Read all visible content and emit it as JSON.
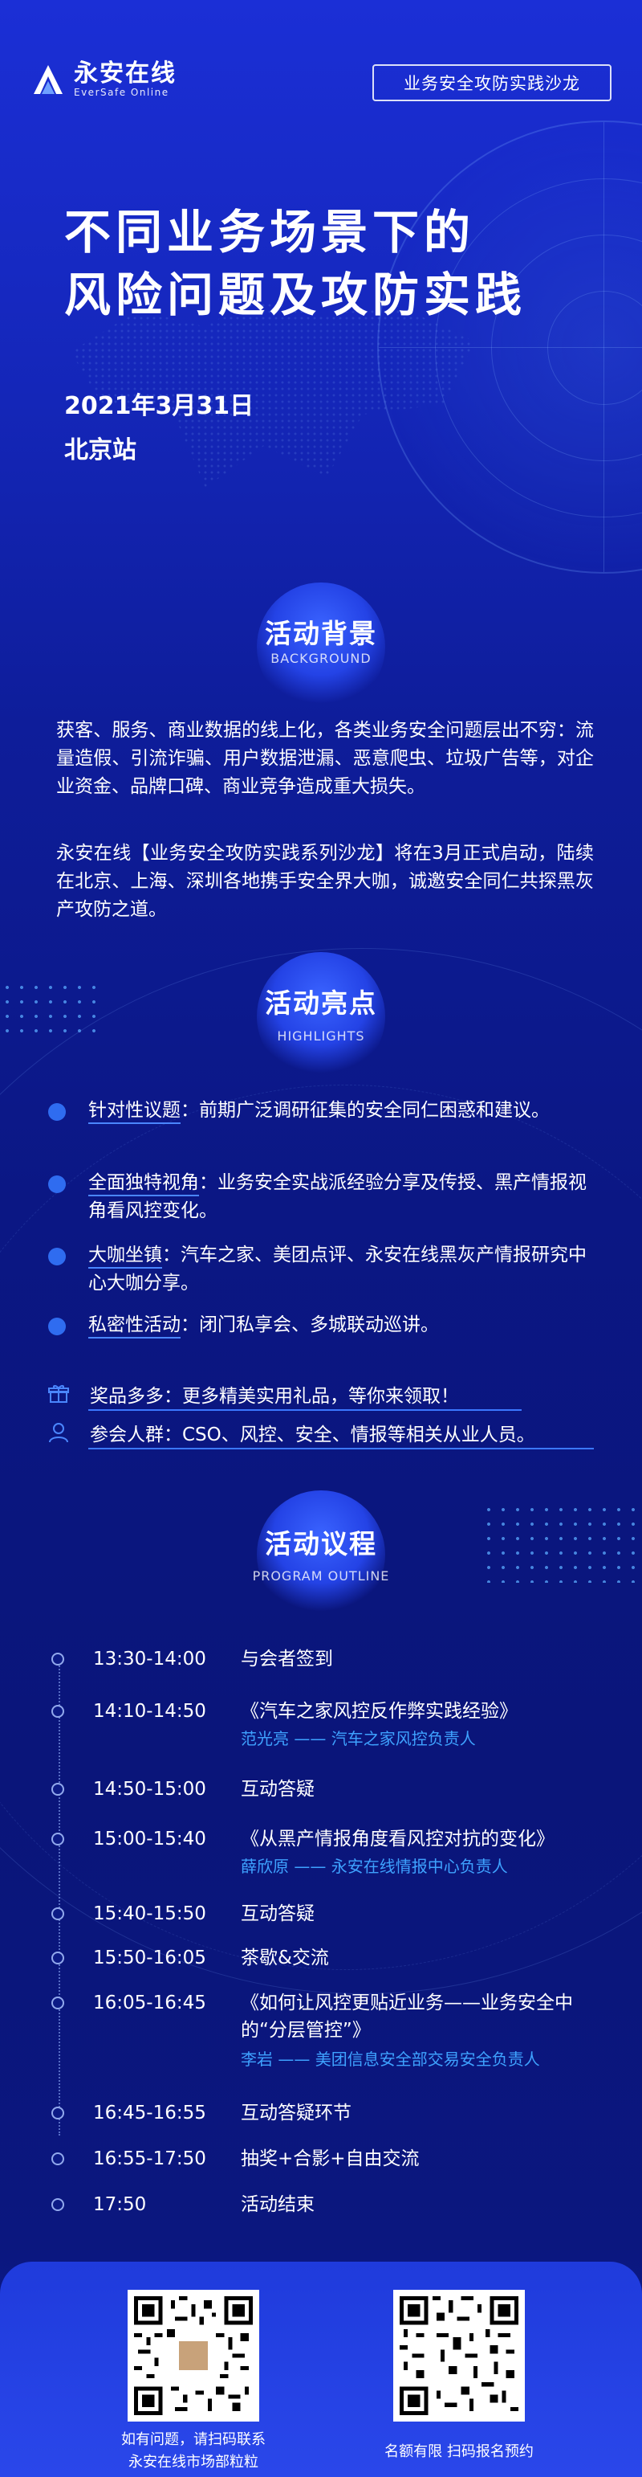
{
  "header": {
    "logo_cn": "永安在线",
    "logo_en": "EverSafe Online",
    "salon_tag": "业务安全攻防实践沙龙"
  },
  "hero": {
    "title_line1": "不同业务场景下的",
    "title_line2": "风险问题及攻防实践",
    "date": "2021年3月31日",
    "venue": "北京站"
  },
  "background": {
    "title": "活动背景",
    "subtitle": "BACKGROUND",
    "para1": "获客、服务、商业数据的线上化，各类业务安全问题层出不穷：流量造假、引流诈骗、用户数据泄漏、恶意爬虫、垃圾广告等，对企业资金、品牌口碑、商业竞争造成重大损失。",
    "para2": "永安在线【业务安全攻防实践系列沙龙】将在3月正式启动，陆续在北京、上海、深圳各地携手安全界大咖，诚邀安全同仁共探黑灰产攻防之道。"
  },
  "highlights": {
    "title": "活动亮点",
    "subtitle": "HIGHLIGHTS",
    "items": [
      {
        "label": "针对性议题",
        "text": "：前期广泛调研征集的安全同仁困惑和建议。"
      },
      {
        "label": "全面独特视角",
        "text": "：业务安全实战派经验分享及传授、黑产情报视角看风控变化。"
      },
      {
        "label": "大咖坐镇",
        "text": "：汽车之家、美团点评、永安在线黑灰产情报研究中心大咖分享。"
      },
      {
        "label": "私密性活动",
        "text": "：闭门私享会、多城联动巡讲。"
      }
    ],
    "prize": "奖品多多：更多精美实用礼品，等你来领取！",
    "audience": "参会人群：CSO、风控、安全、情报等相关从业人员。"
  },
  "agenda": {
    "title": "活动议程",
    "subtitle": "PROGRAM OUTLINE",
    "rows": [
      {
        "time": "13:30-14:00",
        "topic": "与会者签到",
        "speaker": ""
      },
      {
        "time": "14:10-14:50",
        "topic": "《汽车之家风控反作弊实践经验》",
        "speaker": "范光亮 —— 汽车之家风控负责人"
      },
      {
        "time": "14:50-15:00",
        "topic": "互动答疑",
        "speaker": ""
      },
      {
        "time": "15:00-15:40",
        "topic": "《从黑产情报角度看风控对抗的变化》",
        "speaker": "薛欣原 —— 永安在线情报中心负责人"
      },
      {
        "time": "15:40-15:50",
        "topic": "互动答疑",
        "speaker": ""
      },
      {
        "time": "15:50-16:05",
        "topic": "茶歇&交流",
        "speaker": ""
      },
      {
        "time": "16:05-16:45",
        "topic": "《如何让风控更贴近业务——业务安全中的“分层管控”》",
        "speaker": "李岩 —— 美团信息安全部交易安全负责人"
      },
      {
        "time": "16:45-16:55",
        "topic": "互动答疑环节",
        "speaker": ""
      },
      {
        "time": "16:55-17:50",
        "topic": "抽奖+合影+自由交流",
        "speaker": ""
      },
      {
        "time": "17:50",
        "topic": "活动结束",
        "speaker": ""
      }
    ]
  },
  "footer": {
    "qr1_caption_line1": "如有问题，请扫码联系",
    "qr1_caption_line2": "永安在线市场部粒粒",
    "qr2_caption": "名额有限  扫码报名预约"
  },
  "colors": {
    "accent": "#3b78ff",
    "speaker": "#3ea2ff",
    "bullet": "#2f6cf0"
  }
}
